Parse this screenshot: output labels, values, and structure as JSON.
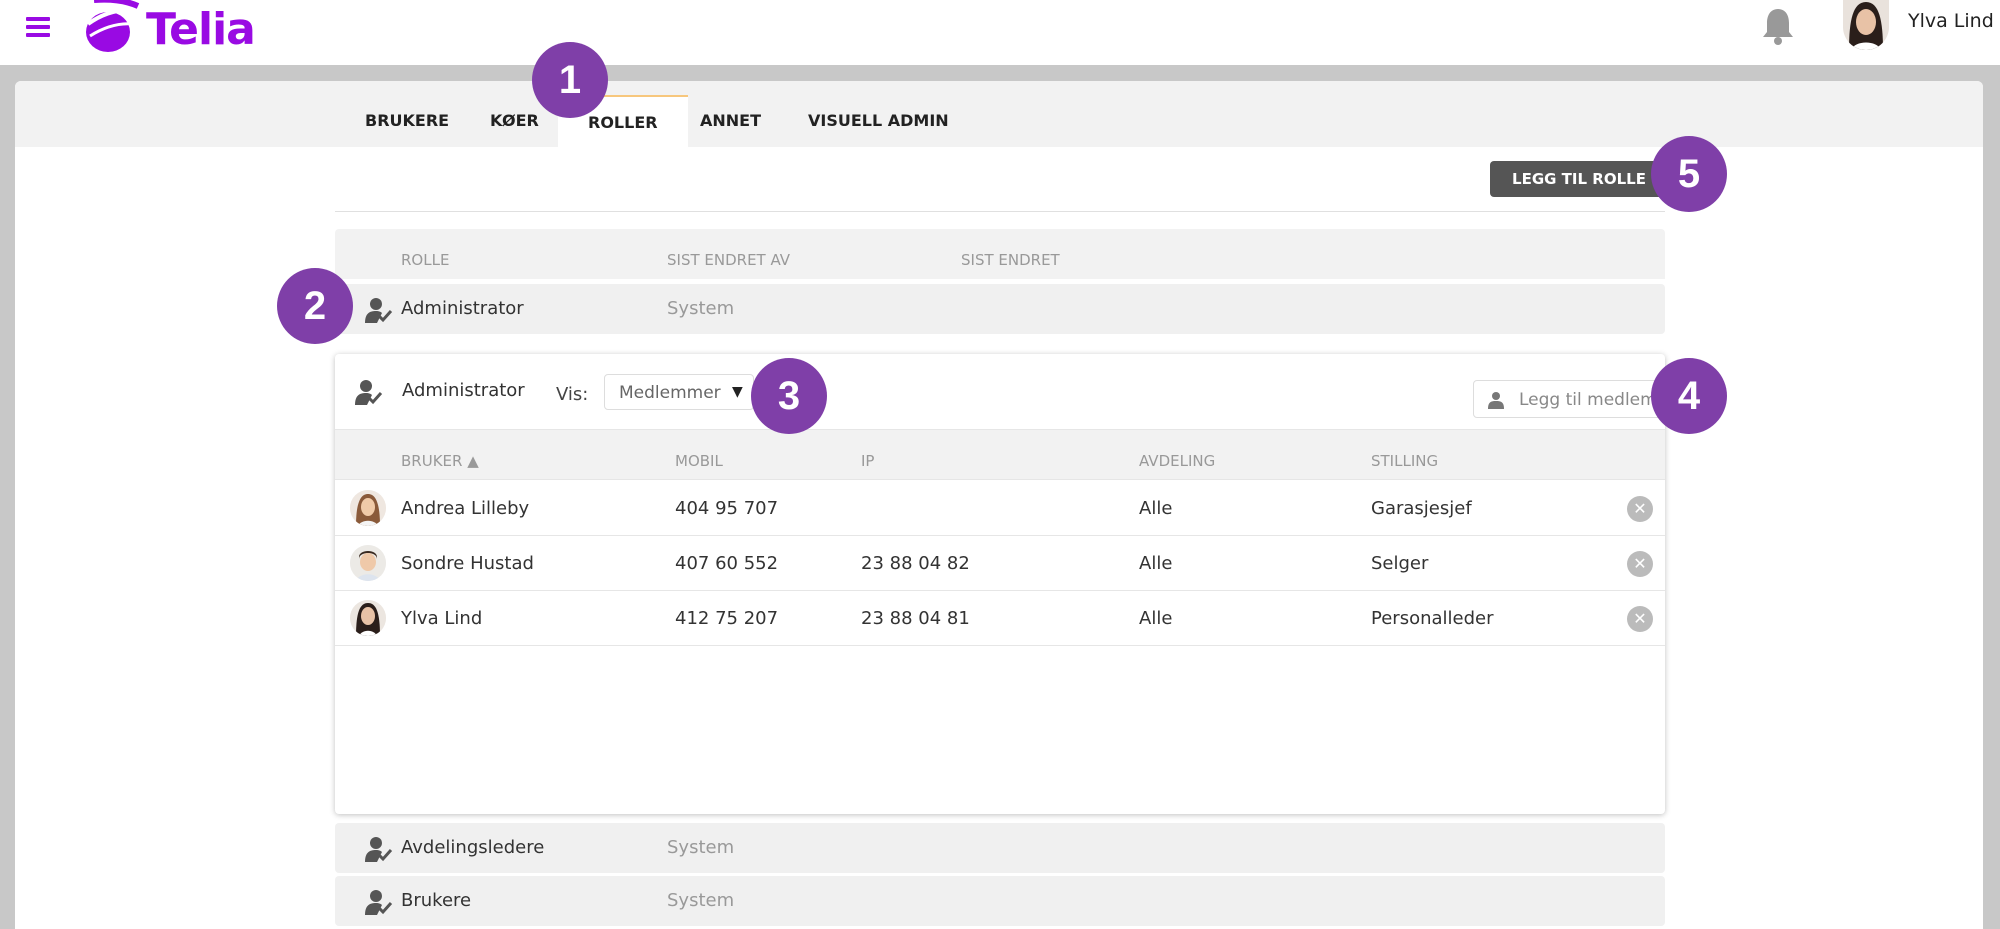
{
  "header": {
    "brand": "Telia",
    "user_name": "Ylva Lind"
  },
  "tabs": [
    {
      "label": "BRUKERE"
    },
    {
      "label": "KØER"
    },
    {
      "label": "ROLLER"
    },
    {
      "label": "ANNET"
    },
    {
      "label": "VISUELL ADMIN"
    }
  ],
  "actions": {
    "add_role_label": "LEGG TIL ROLLE"
  },
  "roles_table": {
    "columns": [
      "ROLLE",
      "SIST ENDRET AV",
      "SIST ENDRET"
    ],
    "rows": [
      {
        "name": "Administrator",
        "changed_by": "System"
      },
      {
        "name": "Avdelingsledere",
        "changed_by": "System"
      },
      {
        "name": "Brukere",
        "changed_by": "System"
      }
    ]
  },
  "panel": {
    "title": "Administrator",
    "vis_label": "Vis:",
    "vis_value": "Medlemmer",
    "add_member_placeholder": "Legg til medlem",
    "columns": [
      "BRUKER ▲",
      "MOBIL",
      "IP",
      "AVDELING",
      "STILLING"
    ],
    "members": [
      {
        "name": "Andrea Lilleby",
        "mobile": "404 95 707",
        "ip": "",
        "department": "Alle",
        "position": "Garasjesjef"
      },
      {
        "name": "Sondre Hustad",
        "mobile": "407 60 552",
        "ip": "23 88 04 82",
        "department": "Alle",
        "position": "Selger"
      },
      {
        "name": "Ylva Lind",
        "mobile": "412 75 207",
        "ip": "23 88 04 81",
        "department": "Alle",
        "position": "Personalleder"
      }
    ]
  },
  "callouts": [
    "1",
    "2",
    "3",
    "4",
    "5"
  ],
  "colors": {
    "brand": "#990ae3",
    "callout": "#7f3fa8",
    "tab_active_accent": "#f7c77d",
    "button_dark": "#555555"
  }
}
